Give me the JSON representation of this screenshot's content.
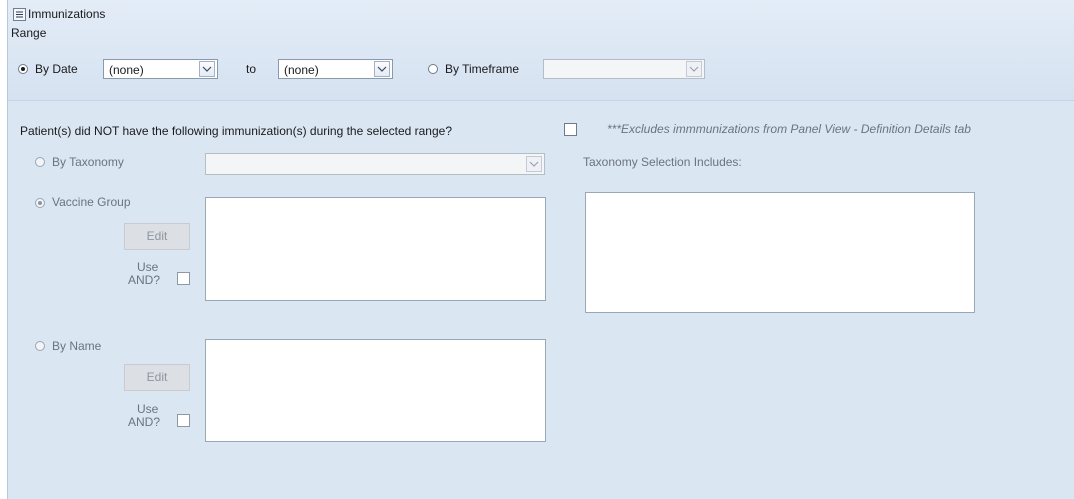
{
  "section": {
    "title": "Immunizations"
  },
  "range": {
    "label": "Range",
    "by_date_label": "By Date",
    "from_value": "(none)",
    "to_label": "to",
    "to_value": "(none)",
    "by_timeframe_label": "By Timeframe",
    "timeframe_value": ""
  },
  "question": {
    "text": "Patient(s) did NOT have the following immunization(s) during the selected range?",
    "note": "***Excludes immmunizations from Panel View - Definition Details tab"
  },
  "taxonomy": {
    "label": "By Taxonomy",
    "value": "",
    "includes_label": "Taxonomy Selection Includes:"
  },
  "vaccine_group": {
    "label": "Vaccine Group",
    "edit_label": "Edit",
    "use_and_line1": "Use",
    "use_and_line2": "AND?"
  },
  "by_name": {
    "label": "By Name",
    "edit_label": "Edit",
    "use_and_line1": "Use",
    "use_and_line2": "AND?"
  }
}
